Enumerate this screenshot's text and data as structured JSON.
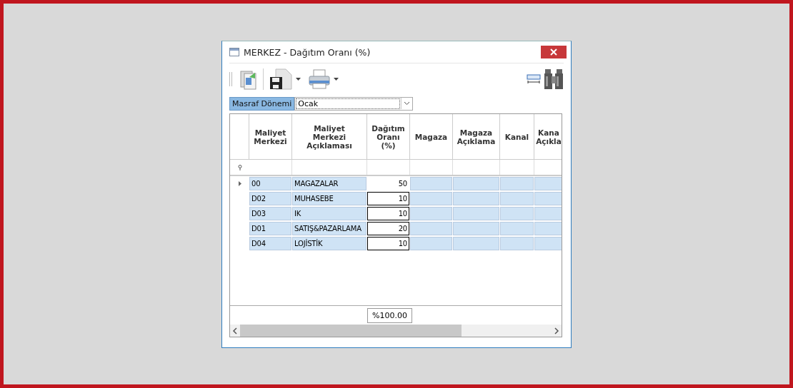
{
  "window": {
    "title": "MERKEZ - Dağıtım Oranı (%)"
  },
  "filter": {
    "label": "Masraf Dönemi",
    "value": "Ocak"
  },
  "table": {
    "columns": [
      {
        "lines": [
          "Maliyet",
          "Merkezi"
        ],
        "kind": "text"
      },
      {
        "lines": [
          "Maliyet",
          "Merkezi",
          "Açıklaması"
        ],
        "kind": "text"
      },
      {
        "lines": [
          "Dağıtım",
          "Oranı",
          "(%)"
        ],
        "kind": "number"
      },
      {
        "lines": [
          "Magaza"
        ],
        "kind": "text"
      },
      {
        "lines": [
          "Magaza",
          "Açıklama"
        ],
        "kind": "text"
      },
      {
        "lines": [
          "Kanal"
        ],
        "kind": "text"
      },
      {
        "lines": [
          "Kana",
          "Açıkla"
        ],
        "kind": "text"
      }
    ],
    "rows": [
      {
        "current": true,
        "cells": [
          "00",
          "MAGAZALAR",
          "50",
          "",
          "",
          "",
          ""
        ]
      },
      {
        "current": false,
        "cells": [
          "D02",
          "MUHASEBE",
          "10",
          "",
          "",
          "",
          ""
        ]
      },
      {
        "current": false,
        "cells": [
          "D03",
          "IK",
          "10",
          "",
          "",
          "",
          ""
        ]
      },
      {
        "current": false,
        "cells": [
          "D01",
          "SATIŞ&PAZARLAMA",
          "20",
          "",
          "",
          "",
          ""
        ]
      },
      {
        "current": false,
        "cells": [
          "D04",
          "LOJİSTİK",
          "10",
          "",
          "",
          "",
          ""
        ]
      }
    ],
    "total": "%100.00"
  }
}
